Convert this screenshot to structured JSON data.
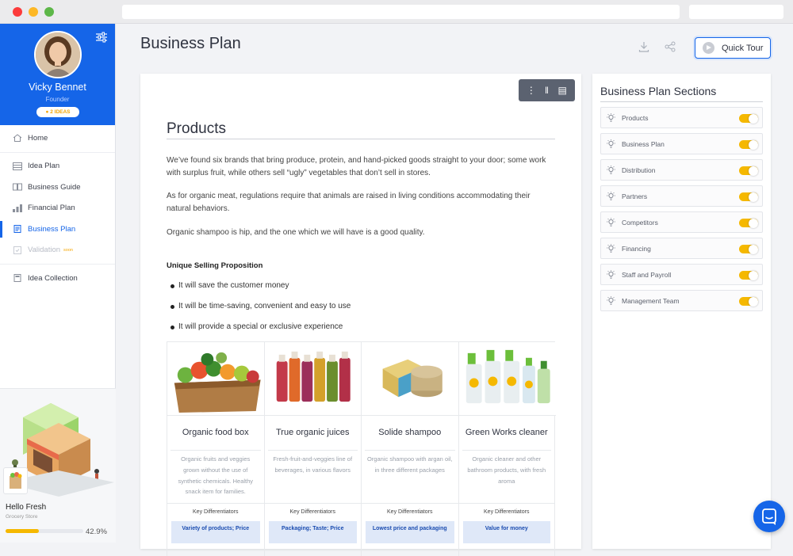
{
  "colors": {
    "accent": "#1565e8",
    "toggle": "#f5b800",
    "progress": "#f5b800"
  },
  "profile": {
    "name": "Vicky Bennet",
    "role": "Founder",
    "badge": "2 IDEAS"
  },
  "nav": [
    {
      "label": "Home",
      "icon": "home-icon"
    },
    {
      "label": "Idea Plan",
      "icon": "idea-plan-icon"
    },
    {
      "label": "Business Guide",
      "icon": "book-icon"
    },
    {
      "label": "Financial Plan",
      "icon": "bar-chart-icon"
    },
    {
      "label": "Business Plan",
      "icon": "document-icon",
      "active": true
    },
    {
      "label": "Validation",
      "icon": "validation-icon",
      "tag": "soon",
      "disabled": true
    },
    {
      "label": "Idea Collection",
      "icon": "collection-icon"
    }
  ],
  "project": {
    "name": "Hello Fresh",
    "category": "Grocery Store",
    "progress": 0.429,
    "progress_label": "42.9%"
  },
  "header": {
    "title": "Business Plan",
    "tour_label": "Quick Tour"
  },
  "content": {
    "heading": "Products",
    "paragraphs": [
      "We’ve found six brands that bring produce, protein, and hand-picked goods straight to your door; some work with surplus fruit, while others sell “ugly” vegetables that don’t sell in stores.",
      "As for organic meat, regulations require that animals are raised in living conditions accommodating their natural behaviors.",
      "Organic shampoo is hip, and the one which we will have is a good quality."
    ],
    "usp_title": "Unique Selling Proposition",
    "usp": [
      "It will save the customer money",
      "It will be time-saving, convenient and easy to use",
      "It will provide a special or exclusive experience"
    ],
    "products": [
      {
        "title": "Organic food box",
        "desc": "Organic fruits and veggies grown without the use of synthetic chemicals. Healthy snack item for families.",
        "kd_label": "Key Differentiators",
        "kd": "Variety of products; Price"
      },
      {
        "title": "True organic juices",
        "desc": "Fresh-fruit-and-veggies line of beverages, in various flavors",
        "kd_label": "Key Differentiators",
        "kd": "Packaging; Taste; Price"
      },
      {
        "title": "Solide shampoo",
        "desc": "Organic shampoo with argan oil, in three different packages",
        "kd_label": "Key Differentiators",
        "kd": "Lowest price and packaging"
      },
      {
        "title": "Green Works cleaner",
        "desc": "Organic cleaner and other bathroom products, with fresh aroma",
        "kd_label": "Key Differentiators",
        "kd": "Value for money"
      }
    ]
  },
  "sections": {
    "title": "Business Plan Sections",
    "items": [
      "Products",
      "Business Plan",
      "Distribution",
      "Partners",
      "Competitors",
      "Financing",
      "Staff and Payroll",
      "Management Team"
    ]
  }
}
